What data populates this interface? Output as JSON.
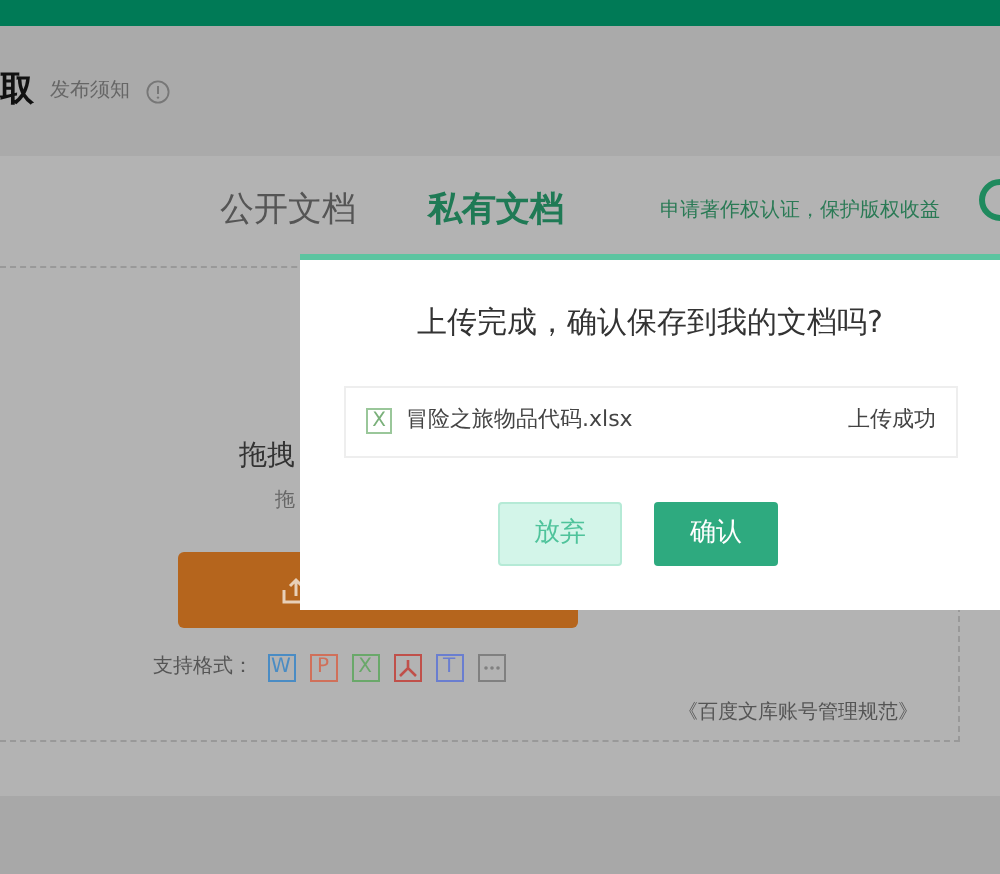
{
  "header": {
    "title": "取",
    "notice": "发布须知"
  },
  "tabs": [
    {
      "label": "公开文档",
      "selected": false
    },
    {
      "label": "私有文档",
      "selected": true
    }
  ],
  "copyright_link": "申请著作权认证，保护版权收益",
  "upload": {
    "drag_title": "拖拽",
    "drag_hint": "拖",
    "formats_label": "支持格式：",
    "formats": [
      {
        "kind": "letter",
        "letter": "W",
        "color": "#4a8cc4"
      },
      {
        "kind": "letter",
        "letter": "P",
        "color": "#d0705a"
      },
      {
        "kind": "letter",
        "letter": "X",
        "color": "#6aa86a"
      },
      {
        "kind": "pdf",
        "color": "#c0504a"
      },
      {
        "kind": "letter",
        "letter": "T",
        "color": "#6a7ed0"
      },
      {
        "kind": "more",
        "color": "#808080"
      }
    ]
  },
  "rules_link": "《百度文库账号管理规范》",
  "dialog": {
    "title": "上传完成，确认保存到我的文档吗?",
    "file": {
      "type_letter": "X",
      "name": "冒险之旅物品代码.xlsx",
      "status": "上传成功"
    },
    "buttons": [
      {
        "label": "放弃",
        "kind": "secondary"
      },
      {
        "label": "确认",
        "kind": "primary"
      }
    ]
  }
}
